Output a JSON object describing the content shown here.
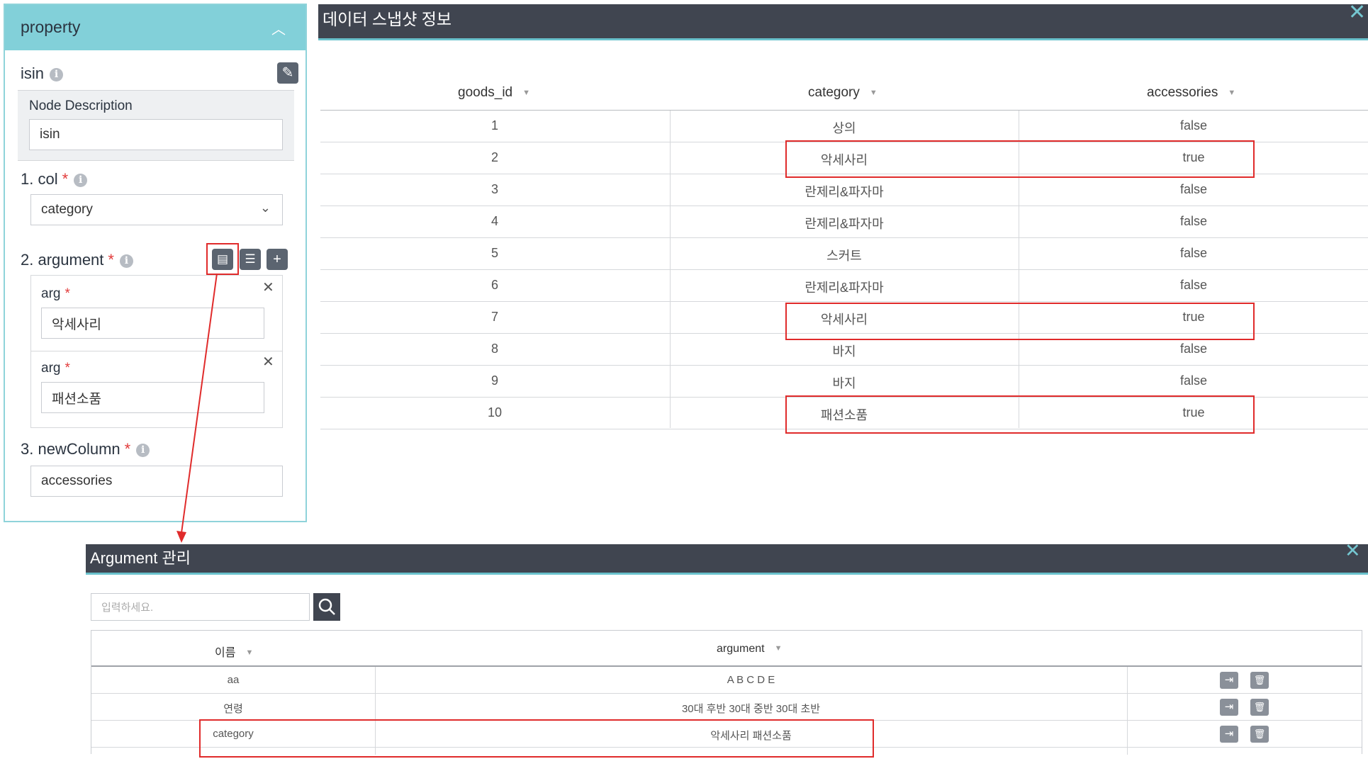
{
  "property_panel": {
    "header": "property",
    "node_name": "isin",
    "node_description": {
      "label": "Node Description",
      "value": "isin"
    },
    "col": {
      "label": "1. col",
      "value": "category"
    },
    "argument": {
      "label": "2. argument",
      "items": [
        {
          "label": "arg",
          "value": "악세사리"
        },
        {
          "label": "arg",
          "value": "패션소품"
        }
      ]
    },
    "new_column": {
      "label": "3. newColumn",
      "value": "accessories"
    },
    "required_mark": "*"
  },
  "snapshot": {
    "title": "데이터 스냅샷 정보",
    "columns": [
      "goods_id",
      "category",
      "accessories"
    ],
    "rows": [
      [
        "1",
        "상의",
        "false"
      ],
      [
        "2",
        "악세사리",
        "true"
      ],
      [
        "3",
        "란제리&파자마",
        "false"
      ],
      [
        "4",
        "란제리&파자마",
        "false"
      ],
      [
        "5",
        "스커트",
        "false"
      ],
      [
        "6",
        "란제리&파자마",
        "false"
      ],
      [
        "7",
        "악세사리",
        "true"
      ],
      [
        "8",
        "바지",
        "false"
      ],
      [
        "9",
        "바지",
        "false"
      ],
      [
        "10",
        "패션소품",
        "true"
      ]
    ],
    "highlighted_rows": [
      2,
      7,
      10
    ]
  },
  "argument_manager": {
    "title": "Argument 관리",
    "search_placeholder": "입력하세요.",
    "columns": [
      "이름",
      "argument"
    ],
    "rows": [
      {
        "name": "aa",
        "argument": "A B C D E"
      },
      {
        "name": "연령",
        "argument": "30대 후반 30대 중반 30대 초반"
      },
      {
        "name": "category",
        "argument": "악세사리 패션소품"
      }
    ]
  },
  "colors": {
    "accent": "#82d0d9",
    "window_header": "#404550",
    "highlight": "#e02b2b"
  }
}
